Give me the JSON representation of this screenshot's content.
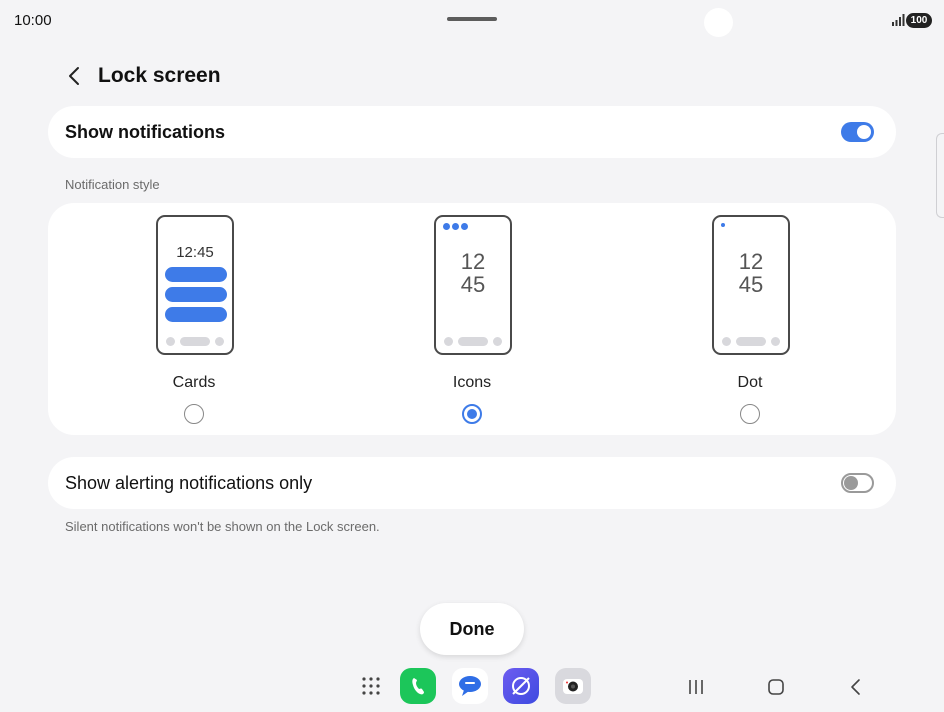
{
  "status_bar": {
    "time": "10:00",
    "battery": "100"
  },
  "header": {
    "title": "Lock screen"
  },
  "show_notifications": {
    "label": "Show notifications",
    "enabled": true
  },
  "notification_style": {
    "section_label": "Notification style",
    "options": [
      {
        "label": "Cards",
        "preview_time": "12:45",
        "selected": false
      },
      {
        "label": "Icons",
        "preview_time_top": "12",
        "preview_time_bottom": "45",
        "selected": true
      },
      {
        "label": "Dot",
        "preview_time_top": "12",
        "preview_time_bottom": "45",
        "selected": false
      }
    ]
  },
  "alerting_only": {
    "label": "Show alerting notifications only",
    "enabled": false,
    "hint": "Silent notifications won't be shown on the Lock screen."
  },
  "done_button": {
    "label": "Done"
  },
  "dock": {
    "apps": [
      "apps-grid-icon",
      "phone-app-icon",
      "messages-app-icon",
      "internet-app-icon",
      "camera-app-icon"
    ],
    "nav": [
      "recents-icon",
      "home-icon",
      "back-icon"
    ]
  },
  "colors": {
    "accent": "#3e7be8",
    "background": "#f4f4f6",
    "card": "#ffffff"
  }
}
